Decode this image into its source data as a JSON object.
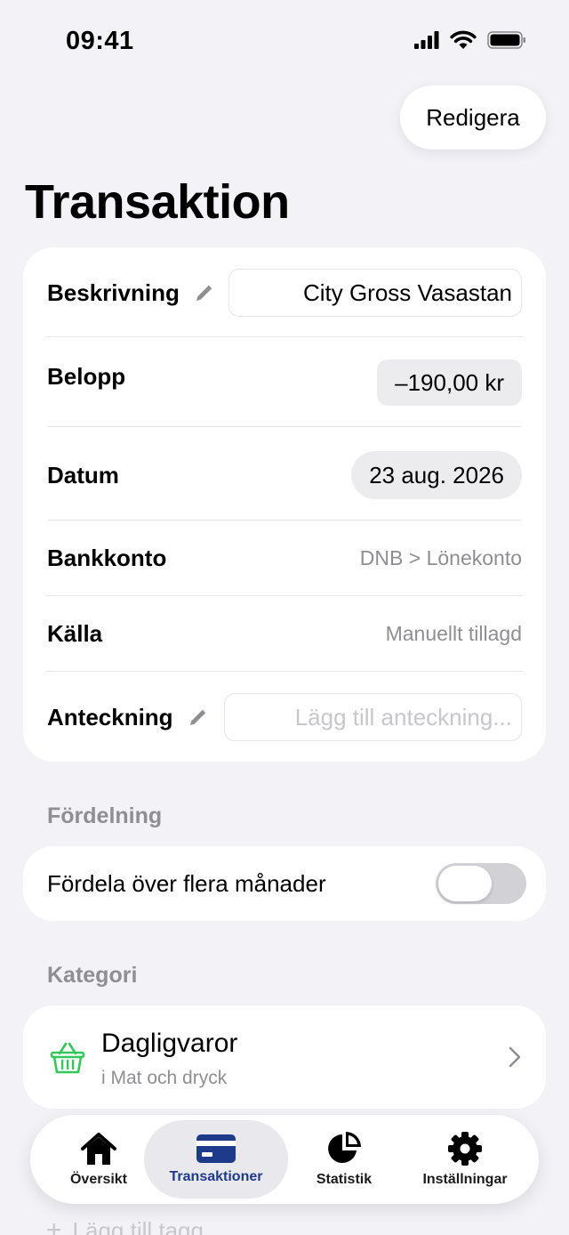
{
  "status_bar": {
    "time": "09:41"
  },
  "header": {
    "edit_label": "Redigera",
    "title": "Transaktion"
  },
  "details": {
    "description": {
      "label": "Beskrivning",
      "value": "City Gross Vasastan"
    },
    "amount": {
      "label": "Belopp",
      "value": "–190,00 kr"
    },
    "date": {
      "label": "Datum",
      "value": "23 aug. 2026"
    },
    "bank_account": {
      "label": "Bankkonto",
      "value": "DNB > Lönekonto"
    },
    "source": {
      "label": "Källa",
      "value": "Manuellt tillagd"
    },
    "note": {
      "label": "Anteckning",
      "placeholder": "Lägg till anteckning..."
    }
  },
  "distribution": {
    "header": "Fördelning",
    "toggle_label": "Fördela över flera månader",
    "enabled": false
  },
  "category": {
    "header": "Kategori",
    "name": "Dagligvaror",
    "parent": "i Mat och dryck",
    "icon": "basket-icon",
    "icon_color": "#34c759"
  },
  "tags": {
    "add_label": "Lägg till tagg"
  },
  "tab_bar": {
    "active": "Transaktioner",
    "accent_color": "#1e3a8a",
    "items": [
      {
        "label": "Översikt",
        "icon": "house-icon"
      },
      {
        "label": "Transaktioner",
        "icon": "card-icon"
      },
      {
        "label": "Statistik",
        "icon": "pie-chart-icon"
      },
      {
        "label": "Inställningar",
        "icon": "gear-icon"
      }
    ]
  }
}
